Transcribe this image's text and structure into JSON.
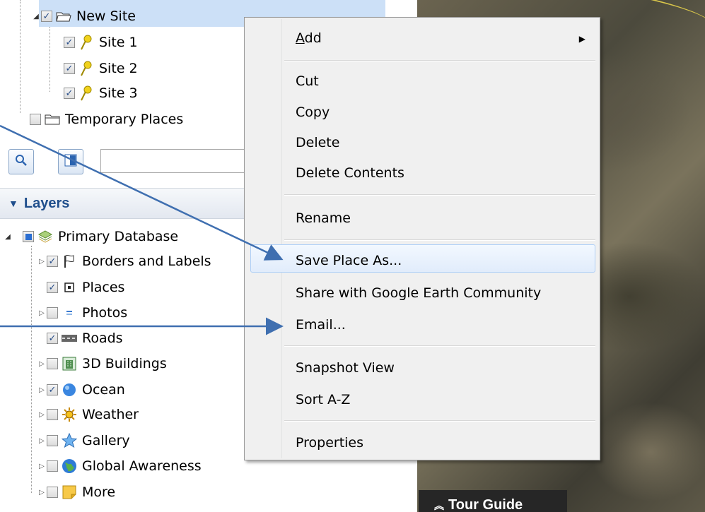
{
  "places_tree": {
    "folder": "New Site",
    "children": [
      "Site 1",
      "Site 2",
      "Site 3"
    ],
    "temporary": "Temporary Places"
  },
  "layers": {
    "header": "Layers",
    "root": "Primary Database",
    "items": [
      {
        "label": "Borders and Labels",
        "checked": true
      },
      {
        "label": "Places",
        "checked": true
      },
      {
        "label": "Photos",
        "checked": false
      },
      {
        "label": "Roads",
        "checked": true
      },
      {
        "label": "3D Buildings",
        "checked": false
      },
      {
        "label": "Ocean",
        "checked": true
      },
      {
        "label": "Weather",
        "checked": false
      },
      {
        "label": "Gallery",
        "checked": false
      },
      {
        "label": "Global Awareness",
        "checked": false
      },
      {
        "label": "More",
        "checked": false
      }
    ]
  },
  "context_menu": {
    "add": "Add",
    "cut": "Cut",
    "copy": "Copy",
    "delete": "Delete",
    "delete_contents": "Delete Contents",
    "rename": "Rename",
    "save_place_as": "Save Place As...",
    "share": "Share with Google Earth Community",
    "email": "Email...",
    "snapshot": "Snapshot View",
    "sort": "Sort A-Z",
    "properties": "Properties"
  },
  "map": {
    "tour_guide": "Tour Guide"
  },
  "colors": {
    "selection": "#cce0f7",
    "layers_header_text": "#1f4e8c",
    "annotation_arrow": "#3f6fb0"
  }
}
